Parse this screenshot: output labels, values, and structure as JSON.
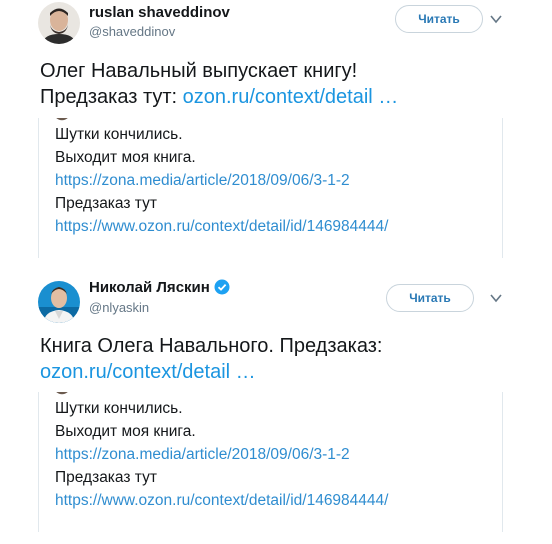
{
  "tweets": [
    {
      "name": "ruslan shaveddinov",
      "handle": "@shaveddinov",
      "follow_label": "Читать",
      "text_line1": "Олег Навальный выпускает книгу!",
      "text_line2_prefix": "Предзаказ тут: ",
      "text_link": "ozon.ru/context/detail …",
      "embed": {
        "line1": "Шутки кончились.",
        "line2": "Выходит моя книга.",
        "line3": "https://zona.media/article/2018/09/06/3-1-2",
        "line4": "Предзаказ тут",
        "line5": "https://www.ozon.ru/context/detail/id/146984444/"
      }
    },
    {
      "name": "Николай Ляскин",
      "handle": "@nlyaskin",
      "follow_label": "Читать",
      "verified": true,
      "text_line1": "Книга Олега Навального. Предзаказ:",
      "text_link": "ozon.ru/context/detail …",
      "embed": {
        "line1": "Шутки кончились.",
        "line2": "Выходит моя книга.",
        "line3": "https://zona.media/article/2018/09/06/3-1-2",
        "line4": "Предзаказ тут",
        "line5": "https://www.ozon.ru/context/detail/id/146984444/"
      }
    }
  ],
  "colors": {
    "link": "#1b95e0",
    "follow_text": "#2a79b5",
    "verified": "#1da1f2",
    "handle": "#657786"
  },
  "icons": [
    "avatar",
    "verified-badge-icon",
    "chevron-down-icon"
  ]
}
